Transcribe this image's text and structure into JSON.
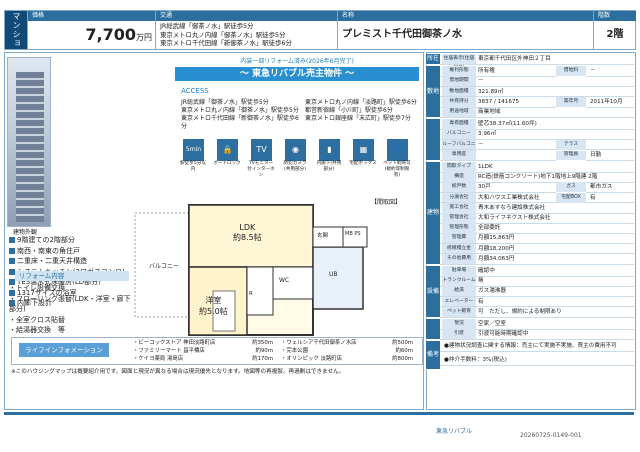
{
  "header": {
    "category": "マンション",
    "price_label": "価格",
    "price_value": "7,700",
    "price_unit": "万円",
    "transport_label": "交通",
    "transport_lines": [
      "JR総武線「御茶ノ水」駅徒歩5分",
      "東京メトロ丸ノ内線「御茶ノ水」駅徒歩5分",
      "東京メトロ千代田線「新御茶ノ水」駅徒歩6分"
    ],
    "name_label": "名称",
    "name_value": "プレミスト千代田御茶ノ水",
    "floor_label": "階数",
    "floor_value": "2階"
  },
  "left": {
    "photo_tag": "建物外観",
    "banner_top": "内装一部リフォーム済み(2026年6月完了)",
    "banner_main": "～ 東急リバブル売主物件 ～",
    "access_title": "ACCESS",
    "access": [
      "JR総武線「御茶ノ水」駅徒歩5分",
      "東京メトロ丸ノ内線「淡路町」駅徒歩6分",
      "東京メトロ丸ノ内線「御茶ノ水」駅徒歩5分",
      "都営新宿線「小川町」駅徒歩6分",
      "東京メトロ千代田線「新御茶ノ水」駅徒歩6分",
      "東京メトロ銀座線「末広町」駅徒歩7分"
    ],
    "icons": [
      {
        "glyph": "5min",
        "label": "駅徒歩5分以内"
      },
      {
        "glyph": "🔒",
        "label": "オートロック"
      },
      {
        "glyph": "TV",
        "label": "TVモニター付インターホン"
      },
      {
        "glyph": "◉",
        "label": "防犯カメラ(共用部分)"
      },
      {
        "glyph": "▮",
        "label": "内廊下(共用部分)"
      },
      {
        "glyph": "▦",
        "label": "宅配ボックス"
      },
      {
        "glyph": "🐾",
        "label": "ペット飼育可(規約等制限有)"
      }
    ],
    "features": [
      "9階建ての2階部分",
      "南西・南東の角住戸",
      "二重床・二重天井構造",
      "システムキッチン(2口ガスコンロ)",
      "TES温水式床暖房(LD部分)",
      "1317サイズの浴室",
      "内廊下設計"
    ],
    "reform_title": "リフォーム内容",
    "reform": [
      "・トイレ設備交換",
      "・フローリング張替(LDK・洋室・廊下部分)",
      "・全室クロス貼替",
      "・給湯器交換　等"
    ],
    "plan": {
      "tag": "【間取図】",
      "ldk": "LDK",
      "ldk_size": "約8.5帖",
      "room": "洋室",
      "room_size": "約5.0帖",
      "balcony": "バルコニー",
      "closet": "クローゼット",
      "wc": "WC",
      "ub": "UB",
      "entrance": "玄関",
      "mbps": "MB PS",
      "r": "R"
    },
    "life_title": "ライフインフォメーション",
    "life": [
      {
        "name": "・ビーコックストア 神田淡路町店",
        "dist": "約350m"
      },
      {
        "name": "・ウェルシア千代田御茶ノ水店",
        "dist": "約500m"
      },
      {
        "name": "・ファミリーマート 昌平橋店",
        "dist": "約90m"
      },
      {
        "name": "・完本公園",
        "dist": "約60m"
      },
      {
        "name": "・ケイヨ薬局 湯島店",
        "dist": "約170m"
      },
      {
        "name": "・オリンピック 淡路町店",
        "dist": "約800m"
      }
    ],
    "note": "※このハウジングマップは概要紹介用です。図面と現況が異なる場合は現況優先となります。地図等の再複製、再過剰はできません。"
  },
  "right": {
    "groups": [
      {
        "side": "所在",
        "rows": [
          {
            "label": "住居表示(住居記号)",
            "value": "東京都千代田区外神田２丁目"
          }
        ]
      },
      {
        "side": "敷地",
        "rows": [
          {
            "label": "権利形態",
            "value": "所有権"
          },
          {
            "label": "借地期間",
            "value": "－"
          },
          {
            "label": "敷地面積",
            "value": "321.89㎡"
          },
          {
            "label": "共有持分",
            "value": "3837 / 141675"
          },
          {
            "label": "用途地域",
            "value": "商業地域"
          }
        ]
      },
      {
        "side": "",
        "rows": [
          {
            "label": "専有面積",
            "value": "壁芯38.37㎡(11.60坪)"
          },
          {
            "label": "バルコニー",
            "value": "3.96㎡"
          },
          {
            "label": "ルーフバルコニー",
            "value": "－"
          },
          {
            "label": "専用庭",
            "value": ""
          }
        ]
      },
      {
        "side": "建物",
        "rows": [
          {
            "label": "間取タイプ",
            "value": "1LDK"
          },
          {
            "label": "構造",
            "value": "RC造(鉄筋コンクリート)地下1階地上9階建 2階"
          },
          {
            "label": "総戸数",
            "value": "30戸"
          },
          {
            "label": "分譲会社",
            "value": "大和ハウス工業株式会社"
          },
          {
            "label": "施工会社",
            "value": "青木あすなろ建設株式会社"
          },
          {
            "label": "管理会社",
            "value": "大和ライフネクスト株式会社"
          },
          {
            "label": "管理形態",
            "value": "全部委託"
          },
          {
            "label": "管理費",
            "value": "月額15,863円"
          },
          {
            "label": "修繕積立金",
            "value": "月額18,200円"
          },
          {
            "label": "その他費用",
            "value": "月額34,063円"
          }
        ]
      },
      {
        "side": "設備",
        "rows": [
          {
            "label": "駐車場",
            "value": "確認中"
          },
          {
            "label": "トランクルーム",
            "value": "無"
          },
          {
            "label": "給湯",
            "value": "ガス湯沸器"
          },
          {
            "label": "エレベーター",
            "value": "有"
          },
          {
            "label": "ペット飼育",
            "value": "可　ただし、規約による制限あり"
          }
        ]
      },
      {
        "side": "",
        "rows": [
          {
            "label": "現況",
            "value": "空家／空室"
          },
          {
            "label": "引渡",
            "value": "引渡可能時期確認中"
          }
        ]
      },
      {
        "side": "備考",
        "rows": [
          {
            "label": "",
            "value": "●建物状況調査に関する情報：売主にて実施不実施、買主の費用不可"
          },
          {
            "label": "",
            "value": "●仲介手数料：3%(税込)"
          }
        ]
      }
    ],
    "extra": {
      "shared_label": "借地料",
      "shared_value": "－",
      "built_label": "築年月",
      "built_value": "2011年10月",
      "tennant_label": "管理員",
      "tennant_value": "日勤",
      "gas_label": "ガス",
      "gas_value": "都市ガス",
      "delivery_label": "宅配BOX",
      "delivery_value": "有",
      "terrace_label": "テラス",
      "terrace_value": ""
    }
  },
  "footer": {
    "mark": "東急リバブル",
    "code": "20260725-0149-001"
  }
}
